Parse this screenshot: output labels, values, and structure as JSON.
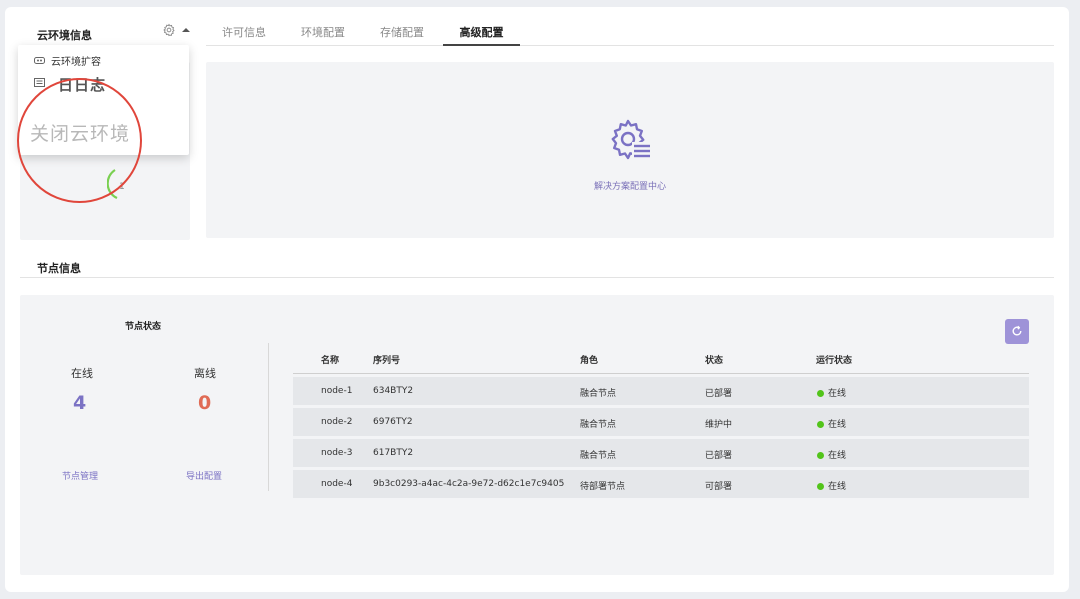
{
  "cloud_info": {
    "title": "云环境信息"
  },
  "dropdown": {
    "items": [
      {
        "label": "云环境扩容"
      }
    ],
    "overlap_text": "日日志",
    "highlight_label": "关闭云环境"
  },
  "tabs": [
    {
      "label": "许可信息",
      "active": false
    },
    {
      "label": "环境配置",
      "active": false
    },
    {
      "label": "存储配置",
      "active": false
    },
    {
      "label": "高级配置",
      "active": true
    }
  ],
  "solution": {
    "label": "解决方案配置中心"
  },
  "nodes": {
    "title": "节点信息",
    "status_title": "节点状态",
    "online_label": "在线",
    "online_count": "4",
    "offline_label": "离线",
    "offline_count": "0",
    "manage_link": "节点管理",
    "export_link": "导出配置"
  },
  "table": {
    "headers": {
      "name": "名称",
      "serial": "序列号",
      "role": "角色",
      "status": "状态",
      "run": "运行状态"
    },
    "rows": [
      {
        "name": "node-1",
        "serial": "634BTY2",
        "role": "融合节点",
        "status": "已部署",
        "run": "在线"
      },
      {
        "name": "node-2",
        "serial": "6976TY2",
        "role": "融合节点",
        "status": "维护中",
        "run": "在线"
      },
      {
        "name": "node-3",
        "serial": "617BTY2",
        "role": "融合节点",
        "status": "已部署",
        "run": "在线"
      },
      {
        "name": "node-4",
        "serial": "9b3c0293-a4ac-4c2a-9e72-d62c1e7c9405",
        "role": "待部署节点",
        "status": "可部署",
        "run": "在线"
      }
    ]
  },
  "colors": {
    "accent": "#7b72c4",
    "offline": "#e06b55",
    "online_dot": "#52c41a",
    "highlight": "#e0463b"
  },
  "icons": {
    "settings": "gear-icon",
    "caret": "caret-up-icon",
    "refresh": "refresh-icon",
    "solution": "gear-list-icon"
  }
}
